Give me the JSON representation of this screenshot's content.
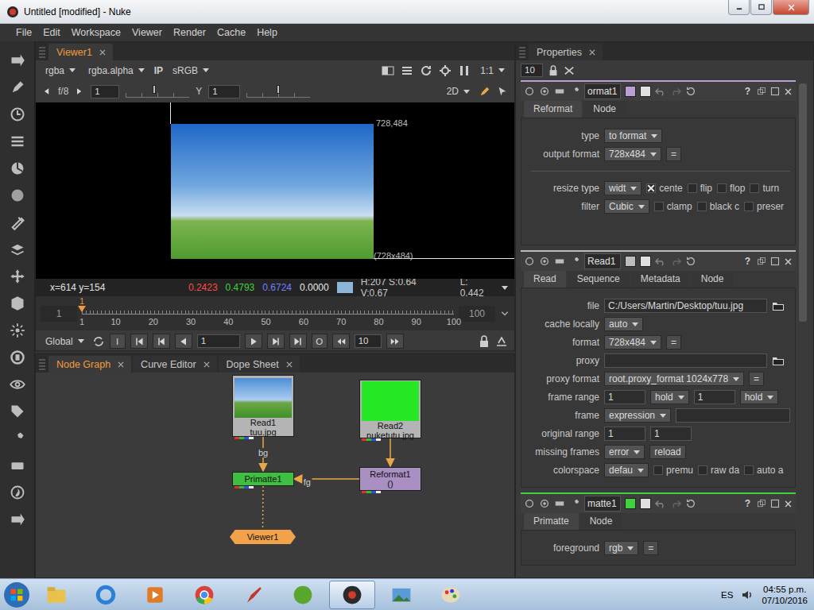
{
  "window": {
    "title": "Untitled [modified] - Nuke"
  },
  "menu": [
    "File",
    "Edit",
    "Workspace",
    "Viewer",
    "Render",
    "Cache",
    "Help"
  ],
  "viewer": {
    "tab": {
      "label": "Viewer1",
      "selected": true
    },
    "channels": "rgba",
    "alpha_channel": "rgba.alpha",
    "input_process": "IP",
    "lut": "sRGB",
    "zoom": "1:1",
    "gain_label": "f/8",
    "gain": "1",
    "gain_level": 0.45,
    "gamma_label": "Y",
    "gamma": "1",
    "gamma_level": 0.5,
    "mode": "2D",
    "format_top": "728,484",
    "format_bottom": "(728x484)",
    "info": {
      "coords": "x=614 y=154",
      "values": [
        {
          "text": "0.2423",
          "color": "#ff4a4a"
        },
        {
          "text": "0.4793",
          "color": "#3ed23e"
        },
        {
          "text": "0.6724",
          "color": "#6f7fff"
        },
        {
          "text": "0.0000",
          "color": "#e6e6e6"
        }
      ],
      "swatch": "#8cb5d9",
      "hsv": "H:207 S:0.64 V:0.67",
      "luminance": "L: 0.442"
    },
    "timeline": {
      "first": "1",
      "last": "100",
      "ticks": [
        "1",
        "10",
        "20",
        "30",
        "40",
        "50",
        "60",
        "70",
        "80",
        "90",
        "100"
      ],
      "current": "1",
      "level": 0
    },
    "playback": {
      "scope": "Global",
      "in": "I",
      "out": "O",
      "frame": "1",
      "increment": "10"
    }
  },
  "node_graph": {
    "tabs": [
      {
        "label": "Node Graph",
        "selected": true
      },
      {
        "label": "Curve Editor",
        "selected": false
      },
      {
        "label": "Dope Sheet",
        "selected": false
      }
    ],
    "nodes": [
      {
        "name": "Read1",
        "sub": "tuu.jpg",
        "kind": "read",
        "color": "#b4b4b4",
        "thumbnail_color": "#4f8fd6"
      },
      {
        "name": "Read2",
        "sub": "nuketutu.jpg",
        "kind": "read",
        "color": "#b4b4b4",
        "thumbnail_color": "#27e827"
      },
      {
        "name": "Primatte1",
        "kind": "op",
        "color": "#3fbf3f"
      },
      {
        "name": "Reformat1",
        "sub": "()",
        "kind": "op",
        "color": "#a98fc2"
      },
      {
        "name": "Viewer1",
        "kind": "viewer",
        "color": "#f2a24a"
      }
    ],
    "edges": [
      {
        "from": "Read1",
        "to": "Primatte1",
        "label": "bg",
        "dashed": false
      },
      {
        "from": "Reformat1",
        "to": "Primatte1",
        "label": "fg",
        "dashed": false
      },
      {
        "from": "Read2",
        "to": "Reformat1",
        "dashed": false
      },
      {
        "from": "Primatte1",
        "to": "Viewer1",
        "dashed": true
      }
    ]
  },
  "properties": {
    "title": "Properties",
    "max_panels": "10",
    "help": "?",
    "panels": [
      {
        "name": "ormat1",
        "color": "#b99fd3",
        "tabs": [
          {
            "label": "Reformat",
            "selected": true
          },
          {
            "label": "Node",
            "selected": false
          }
        ],
        "rows": [
          {
            "kind": "row",
            "label": "type",
            "controls": [
              {
                "kind": "dropdown",
                "text": "to format"
              }
            ]
          },
          {
            "kind": "row",
            "label": "output format",
            "controls": [
              {
                "kind": "dropdown",
                "text": "728x484"
              },
              {
                "kind": "button",
                "text": "="
              }
            ]
          },
          {
            "kind": "divider"
          },
          {
            "kind": "row",
            "label": "resize type",
            "controls": [
              {
                "kind": "dropdown",
                "text": "widt"
              },
              {
                "kind": "check",
                "text": "cente",
                "checked": true
              },
              {
                "kind": "check",
                "text": "flip",
                "checked": false
              },
              {
                "kind": "check",
                "text": "flop",
                "checked": false
              },
              {
                "kind": "check",
                "text": "turn",
                "checked": false
              }
            ]
          },
          {
            "kind": "row",
            "label": "filter",
            "controls": [
              {
                "kind": "dropdown",
                "text": "Cubic"
              },
              {
                "kind": "check",
                "text": "clamp",
                "checked": false
              },
              {
                "kind": "check",
                "text": "black c",
                "checked": false
              },
              {
                "kind": "check",
                "text": "preser",
                "checked": false
              }
            ]
          }
        ]
      },
      {
        "name": "Read1",
        "color": "#bdbdbd",
        "tabs": [
          {
            "label": "Read",
            "selected": true
          },
          {
            "label": "Sequence",
            "selected": false
          },
          {
            "label": "Metadata",
            "selected": false
          },
          {
            "label": "Node",
            "selected": false
          }
        ],
        "rows": [
          {
            "kind": "row",
            "label": "file",
            "controls": [
              {
                "kind": "text",
                "text": "C:/Users/Martin/Desktop/tuu.jpg"
              },
              {
                "kind": "browse"
              }
            ]
          },
          {
            "kind": "row",
            "label": "cache locally",
            "controls": [
              {
                "kind": "dropdown",
                "text": "auto"
              }
            ]
          },
          {
            "kind": "row",
            "label": "format",
            "controls": [
              {
                "kind": "dropdown",
                "text": "728x484"
              },
              {
                "kind": "button",
                "text": "="
              }
            ]
          },
          {
            "kind": "row",
            "label": "proxy",
            "controls": [
              {
                "kind": "text",
                "text": ""
              },
              {
                "kind": "browse"
              }
            ]
          },
          {
            "kind": "row",
            "label": "proxy format",
            "controls": [
              {
                "kind": "dropdown",
                "text": "root.proxy_format 1024x778"
              },
              {
                "kind": "button",
                "text": "="
              }
            ]
          },
          {
            "kind": "row",
            "label": "frame range",
            "controls": [
              {
                "kind": "number",
                "text": "1"
              },
              {
                "kind": "dropdown",
                "text": "hold"
              },
              {
                "kind": "number",
                "text": "1"
              },
              {
                "kind": "dropdown",
                "text": "hold"
              }
            ]
          },
          {
            "kind": "row",
            "label": "frame",
            "controls": [
              {
                "kind": "dropdown",
                "text": "expression"
              },
              {
                "kind": "text",
                "text": ""
              }
            ]
          },
          {
            "kind": "row",
            "label": "original range",
            "controls": [
              {
                "kind": "number",
                "text": "1"
              },
              {
                "kind": "number",
                "text": "1"
              }
            ]
          },
          {
            "kind": "row",
            "label": "missing frames",
            "controls": [
              {
                "kind": "dropdown",
                "text": "error"
              },
              {
                "kind": "button",
                "text": "reload"
              }
            ]
          },
          {
            "kind": "row",
            "label": "colorspace",
            "controls": [
              {
                "kind": "dropdown",
                "text": "defau"
              },
              {
                "kind": "check",
                "text": "premu",
                "checked": false
              },
              {
                "kind": "check",
                "text": "raw da",
                "checked": false
              },
              {
                "kind": "check",
                "text": "auto a",
                "checked": false
              }
            ]
          }
        ]
      },
      {
        "name": "matte1",
        "color": "#3fd23f",
        "tabs": [
          {
            "label": "Primatte",
            "selected": true
          },
          {
            "label": "Node",
            "selected": false
          }
        ],
        "rows": [
          {
            "kind": "row",
            "label": "foreground",
            "controls": [
              {
                "kind": "dropdown",
                "text": "rgb"
              },
              {
                "kind": "button",
                "text": "="
              }
            ]
          }
        ]
      }
    ]
  },
  "taskbar": {
    "language": "ES",
    "time": "04:55 p.m.",
    "date": "07/10/2016"
  }
}
